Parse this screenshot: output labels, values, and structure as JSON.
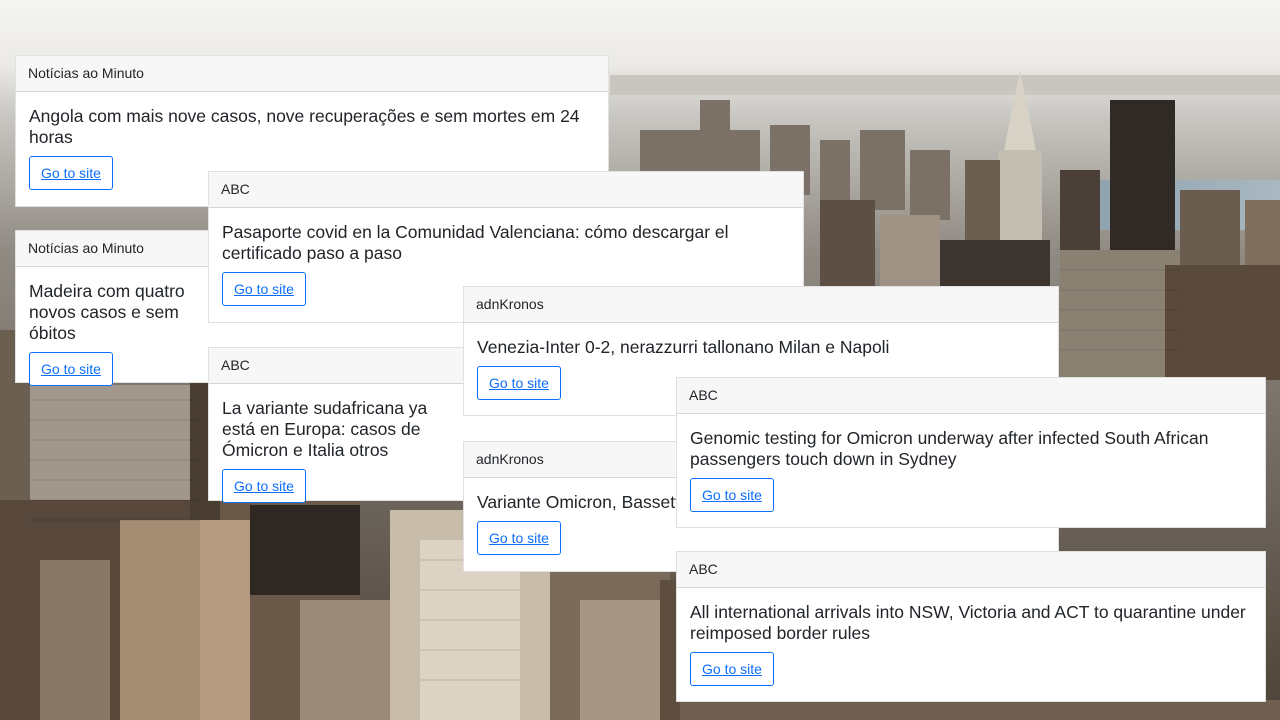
{
  "colors": {
    "link": "#0d6efd",
    "card_header_bg": "#f7f7f7",
    "card_bg": "#ffffff",
    "text": "#212529"
  },
  "cards": [
    {
      "source": "Notícias ao Minuto",
      "title": "Angola com mais nove casos, nove recuperações e sem mortes em 24 horas",
      "button": "Go to site"
    },
    {
      "source": "Notícias ao Minuto",
      "title": "Madeira com quatro novos casos e sem óbitos",
      "button": "Go to site"
    },
    {
      "source": "ABC",
      "title": "Pasaporte covid en la Comunidad Valenciana: cómo descargar el certificado paso a paso",
      "button": "Go to site"
    },
    {
      "source": "ABC",
      "title": "La variante sudafricana ya está en Europa: casos de Ómicron e Italia otros",
      "button": "Go to site"
    },
    {
      "source": "adnKronos",
      "title": "Venezia-Inter 0-2, nerazzurri tallonano Milan e Napoli",
      "button": "Go to site"
    },
    {
      "source": "adnKronos",
      "title": "Variante Omicron, Bassetti",
      "button": "Go to site"
    },
    {
      "source": "ABC",
      "title": "Genomic testing for Omicron underway after infected South African passengers touch down in Sydney",
      "button": "Go to site"
    },
    {
      "source": "ABC",
      "title": "All international arrivals into NSW, Victoria and ACT to quarantine under reimposed border rules",
      "button": "Go to site"
    }
  ]
}
